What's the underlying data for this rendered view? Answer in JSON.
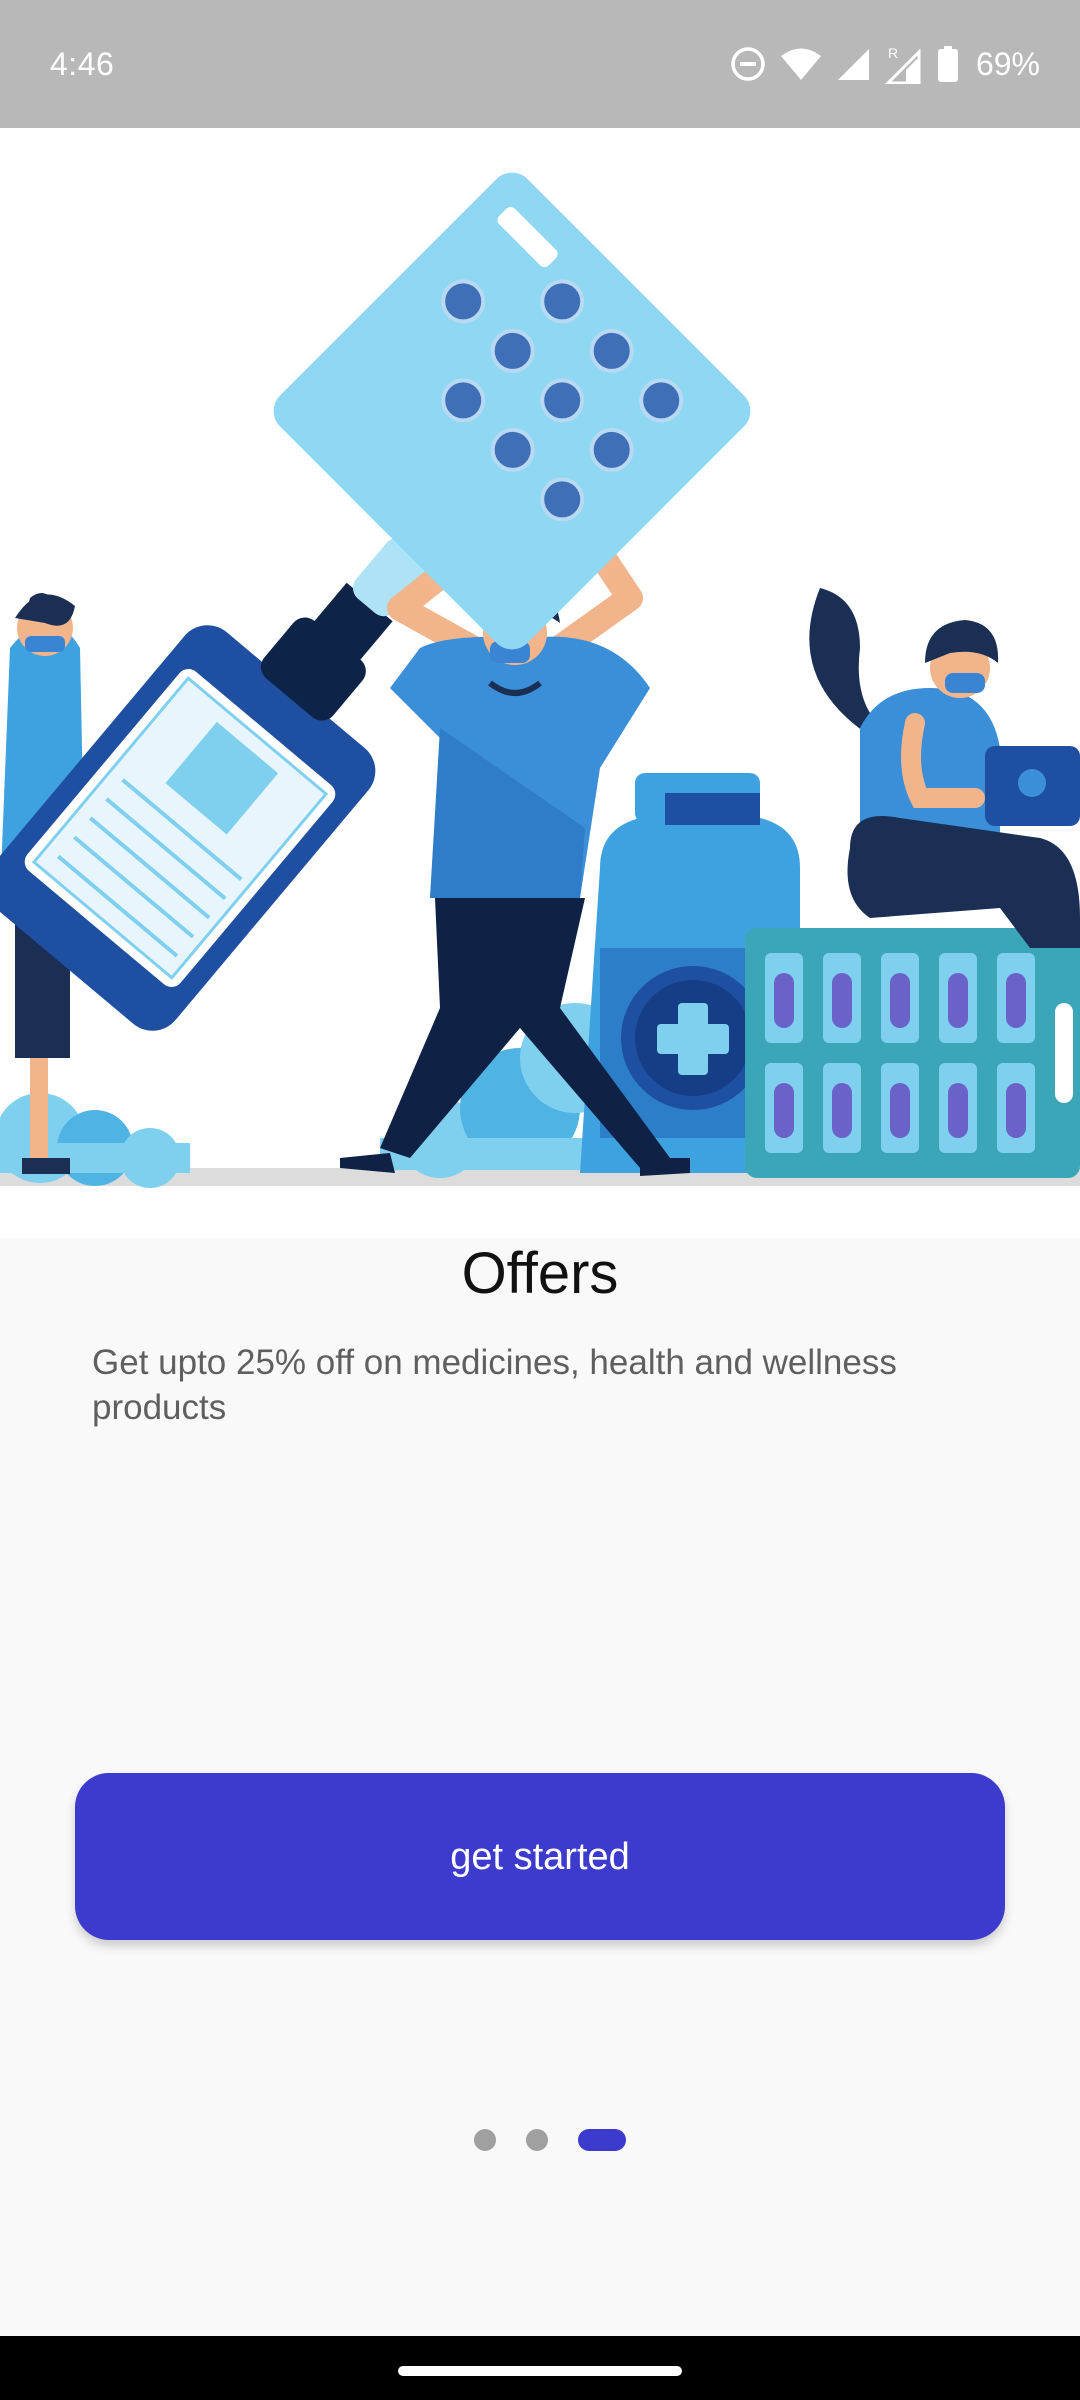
{
  "status_bar": {
    "time": "4:46",
    "battery": "69%",
    "icons": [
      "do-not-disturb-icon",
      "wifi-icon",
      "signal-icon",
      "signal-roaming-icon",
      "battery-icon"
    ]
  },
  "onboarding": {
    "illustration": "pharmacy-offers-illustration",
    "title": "Offers",
    "description": "Get upto 25% off on medicines, health and wellness products",
    "button_label": "get started",
    "pager": {
      "total": 3,
      "current": 3
    }
  },
  "colors": {
    "accent": "#3d3bce",
    "status_bar": "#b8b8b8",
    "background": "#f9f9f9",
    "inactive_dot": "#a0a0a0"
  }
}
